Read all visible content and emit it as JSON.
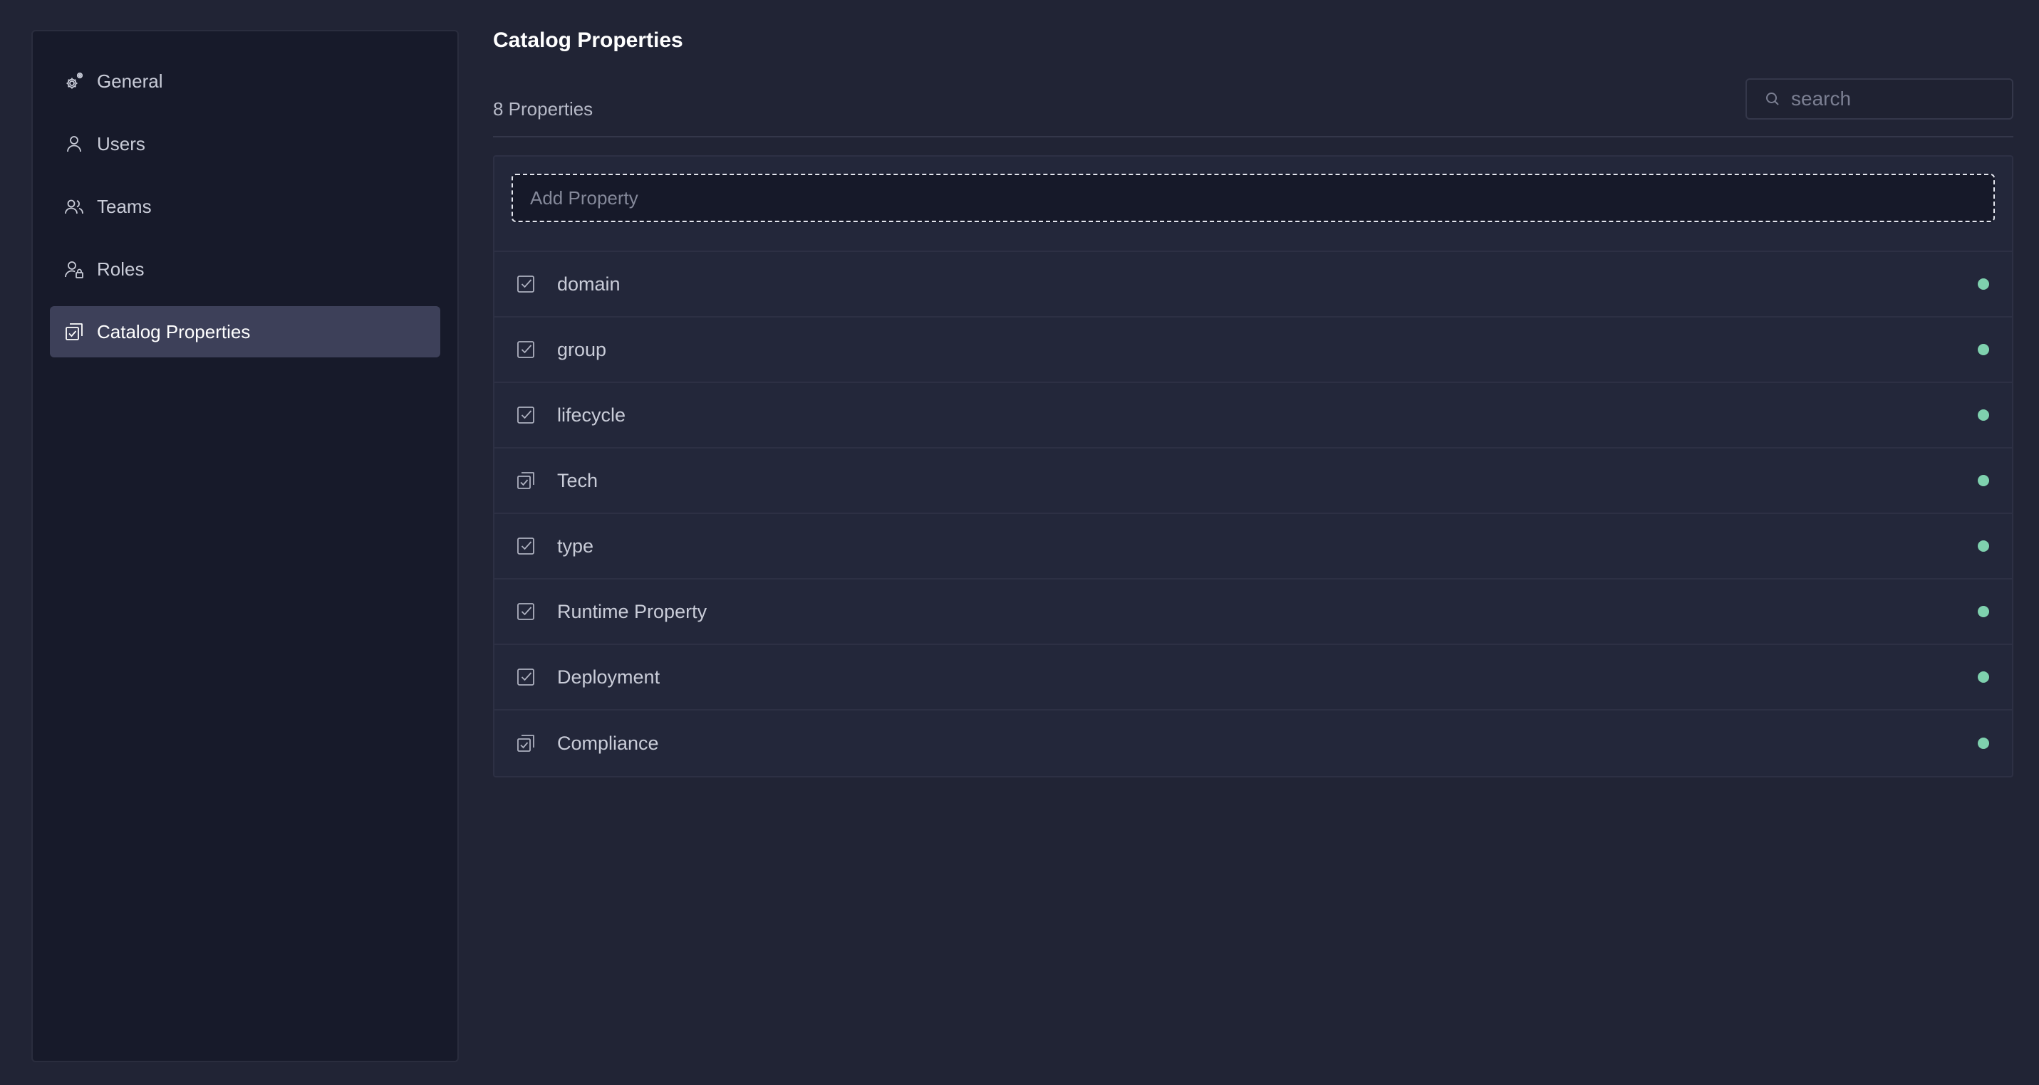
{
  "sidebar": {
    "items": [
      {
        "label": "General",
        "icon": "gear-icon",
        "active": false
      },
      {
        "label": "Users",
        "icon": "user-icon",
        "active": false
      },
      {
        "label": "Teams",
        "icon": "team-icon",
        "active": false
      },
      {
        "label": "Roles",
        "icon": "user-lock-icon",
        "active": false
      },
      {
        "label": "Catalog Properties",
        "icon": "catalog-icon",
        "active": true
      }
    ]
  },
  "main": {
    "title": "Catalog Properties",
    "count_label": "8 Properties",
    "search_placeholder": "search",
    "add_placeholder": "Add Property",
    "status_color": "#7fd1ae",
    "properties": [
      {
        "label": "domain",
        "icon": "checkbox-icon"
      },
      {
        "label": "group",
        "icon": "checkbox-icon"
      },
      {
        "label": "lifecycle",
        "icon": "checkbox-icon"
      },
      {
        "label": "Tech",
        "icon": "multi-checkbox-icon"
      },
      {
        "label": "type",
        "icon": "checkbox-icon"
      },
      {
        "label": "Runtime Property",
        "icon": "checkbox-icon"
      },
      {
        "label": "Deployment",
        "icon": "checkbox-icon"
      },
      {
        "label": "Compliance",
        "icon": "multi-checkbox-icon"
      }
    ]
  }
}
